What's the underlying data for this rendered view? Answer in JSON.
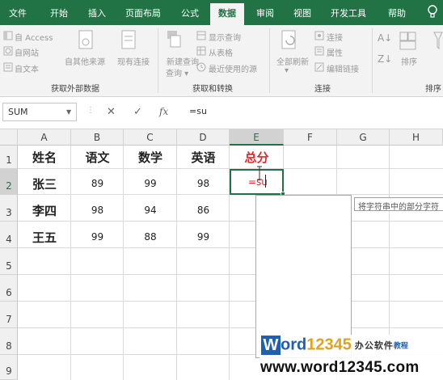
{
  "ribbon": {
    "tabs": [
      "文件",
      "开始",
      "插入",
      "页面布局",
      "公式",
      "数据",
      "审阅",
      "视图",
      "开发工具",
      "帮助"
    ],
    "active_tab": "数据",
    "accent_color": "#217346",
    "get_external_data": {
      "items": [
        "自 Access",
        "自网站",
        "自文本",
        "自其他来源",
        "现有连接"
      ],
      "label": "获取外部数据"
    },
    "get_transform": {
      "new_query": "新建查询",
      "items": [
        "显示查询",
        "从表格",
        "最近使用的源"
      ],
      "label": "获取和转换"
    },
    "connections": {
      "refresh_all": "全部刷新",
      "items": [
        "连接",
        "属性",
        "编辑链接"
      ],
      "label": "连接"
    },
    "sort_filter": {
      "sort": "排序",
      "label": "排序"
    }
  },
  "formula_bar": {
    "name_box": "SUM",
    "cancel": "✕",
    "enter": "✓",
    "fx": "fx",
    "input": "=su"
  },
  "sheet": {
    "columns": [
      "A",
      "B",
      "C",
      "D",
      "E",
      "F",
      "G",
      "H"
    ],
    "rows": [
      "1",
      "2",
      "3",
      "4",
      "5",
      "6",
      "7",
      "8",
      "9"
    ],
    "header_row": [
      "姓名",
      "语文",
      "数学",
      "英语",
      "总分"
    ],
    "data_rows": [
      [
        "张三",
        "89",
        "99",
        "98"
      ],
      [
        "李四",
        "98",
        "94",
        "86"
      ],
      [
        "王五",
        "99",
        "88",
        "99"
      ]
    ],
    "active_cell_text": "=su",
    "tooltip": "将字符串中的部分字符"
  },
  "watermark": {
    "w": "W",
    "ord": "ord",
    "num": "12345",
    "cn": "办公软件",
    "cn2": "教程",
    "url": "www.word12345.com"
  }
}
